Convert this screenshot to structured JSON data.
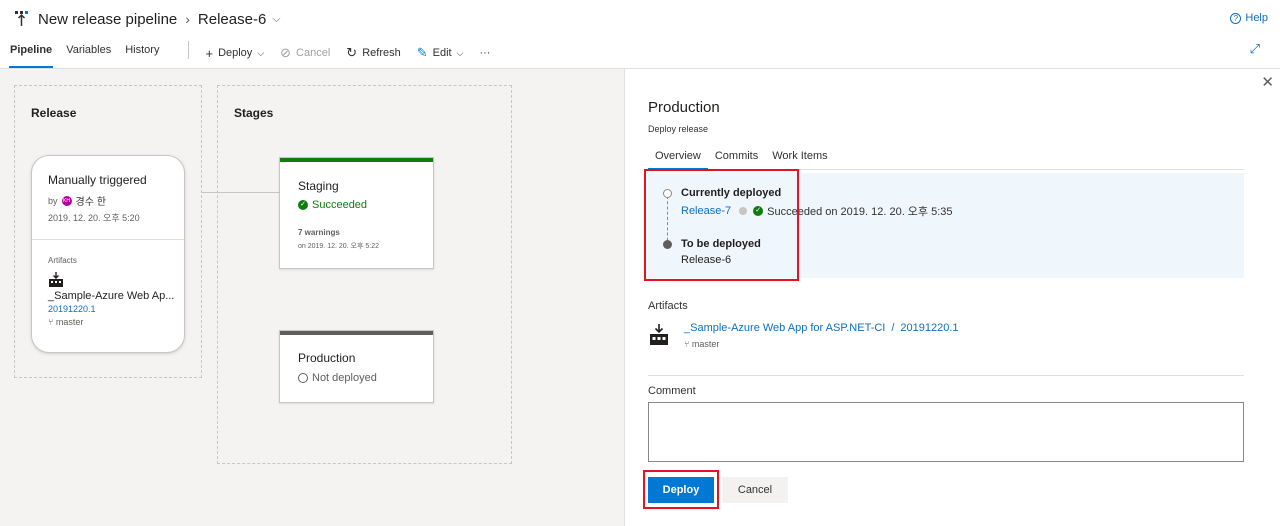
{
  "header": {
    "pipeline_name": "New release pipeline",
    "release_name": "Release-6",
    "help_label": "Help"
  },
  "toolbar": {
    "tabs": [
      "Pipeline",
      "Variables",
      "History"
    ],
    "deploy_label": "Deploy",
    "cancel_label": "Cancel",
    "refresh_label": "Refresh",
    "edit_label": "Edit",
    "more_label": "···"
  },
  "canvas": {
    "release_title": "Release",
    "stages_title": "Stages",
    "release_card": {
      "trigger": "Manually triggered",
      "by_label": "by",
      "avatar_initials": "KH",
      "user": "경수 한",
      "date": "2019. 12. 20. 오후 5:20",
      "artifacts_label": "Artifacts",
      "artifact_name": "_Sample-Azure Web Ap...",
      "build": "20191220.1",
      "branch": "master"
    },
    "stages": [
      {
        "name": "Staging",
        "status": "Succeeded",
        "warnings": "7 warnings",
        "date": "on 2019. 12. 20. 오후 5:22",
        "color": "#107c10"
      },
      {
        "name": "Production",
        "status": "Not deployed",
        "color": "#605e5c"
      }
    ]
  },
  "panel": {
    "title": "Production",
    "subtitle": "Deploy release",
    "tabs": [
      "Overview",
      "Commits",
      "Work Items"
    ],
    "currently_deployed_label": "Currently deployed",
    "current_release": "Release-7",
    "current_status": "Succeeded on 2019. 12. 20. 오후 5:35",
    "to_be_deployed_label": "To be deployed",
    "to_be_release": "Release-6",
    "artifacts_label": "Artifacts",
    "artifact_name": "_Sample-Azure Web App for ASP.NET-CI",
    "artifact_sep": "/",
    "artifact_build": "20191220.1",
    "artifact_branch": "master",
    "comment_label": "Comment",
    "comment_value": "",
    "deploy_button": "Deploy",
    "cancel_button": "Cancel"
  },
  "colors": {
    "accent": "#0078d4",
    "success": "#107c10",
    "highlight": "#e81123"
  },
  "icons": [
    "pipeline-icon",
    "help-icon",
    "plus-icon",
    "chevron-down-icon",
    "cancel-icon",
    "refresh-icon",
    "edit-icon",
    "expand-icon",
    "close-icon",
    "check-circle-icon",
    "artifact-icon",
    "branch-icon"
  ]
}
